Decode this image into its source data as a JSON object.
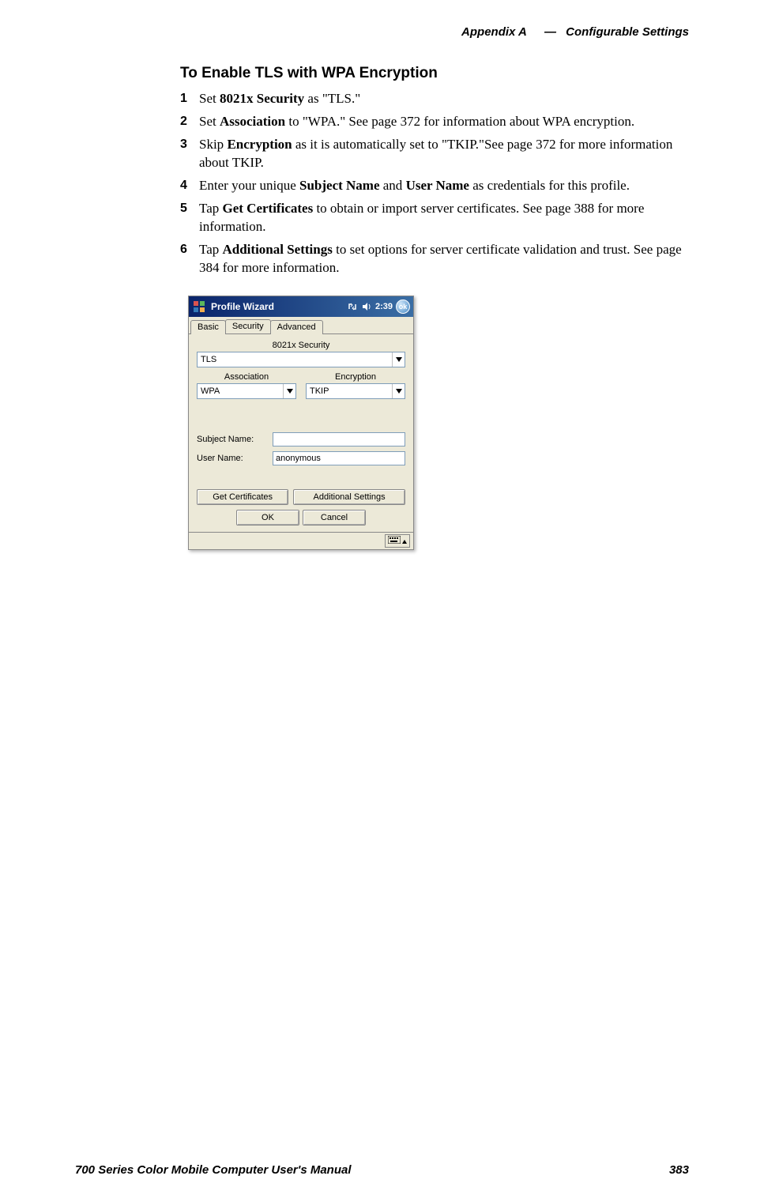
{
  "header": {
    "appendix": "Appendix A",
    "dash": "—",
    "title": "Configurable Settings"
  },
  "section": {
    "title": "To Enable TLS with WPA Encryption"
  },
  "steps": {
    "1": {
      "num": "1",
      "pre": "Set ",
      "bold": "8021x Security",
      "post": " as \"TLS.\""
    },
    "2": {
      "num": "2",
      "pre": "Set ",
      "bold": "Association",
      "post": " to \"WPA.\" See page 372 for information about WPA encryption."
    },
    "3": {
      "num": "3",
      "pre": "Skip ",
      "bold": "Encryption",
      "post": " as it is automatically set to \"TKIP.\"See page 372 for more information about TKIP."
    },
    "4": {
      "num": "4",
      "pre": "Enter your unique ",
      "bold1": "Subject Name",
      "mid": " and ",
      "bold2": "User Name",
      "post": " as credentials for this profile."
    },
    "5": {
      "num": "5",
      "pre": "Tap ",
      "bold": "Get Certificates",
      "post": " to obtain or import server certificates. See page 388 for more information."
    },
    "6": {
      "num": "6",
      "pre": "Tap ",
      "bold": "Additional Settings",
      "post": " to set options for server certificate validation and trust. See page 384 for more information."
    }
  },
  "dialog": {
    "title": "Profile Wizard",
    "time": "2:39",
    "ok": "ok",
    "tabs": {
      "basic": "Basic",
      "security": "Security",
      "advanced": "Advanced"
    },
    "security_group_label": "8021x Security",
    "security_value": "TLS",
    "assoc_label": "Association",
    "assoc_value": "WPA",
    "enc_label": "Encryption",
    "enc_value": "TKIP",
    "subject_label": "Subject Name:",
    "subject_value": "",
    "user_label": "User Name:",
    "user_value": "anonymous",
    "get_cert_btn": "Get Certificates",
    "add_settings_btn": "Additional Settings",
    "ok_btn": "OK",
    "cancel_btn": "Cancel"
  },
  "footer": {
    "manual": "700 Series Color Mobile Computer User's Manual",
    "page": "383"
  }
}
